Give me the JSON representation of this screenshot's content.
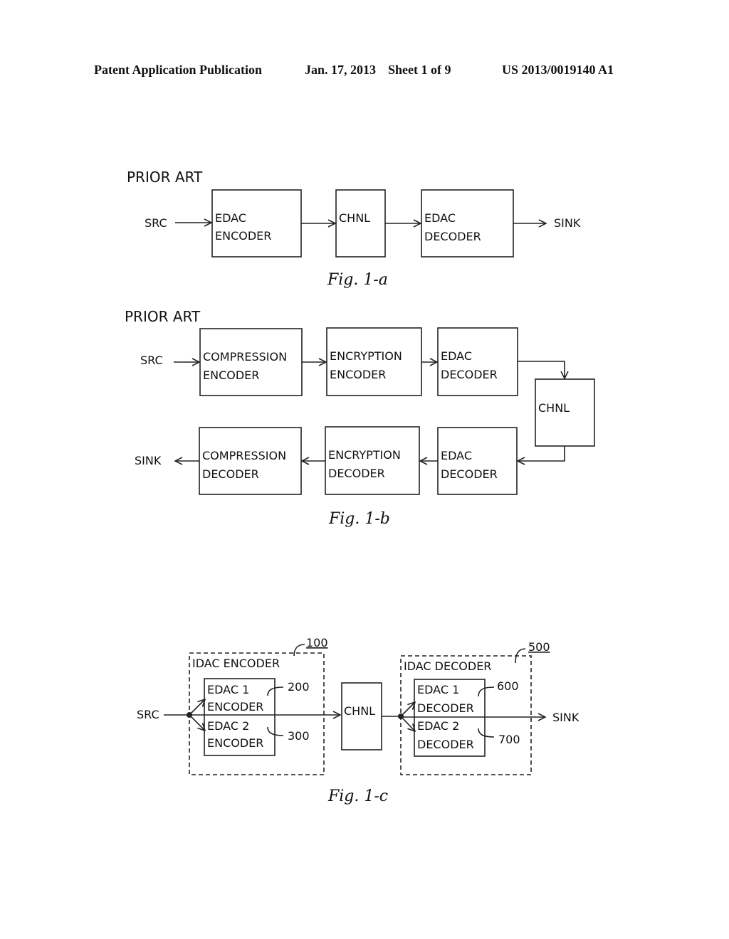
{
  "header": {
    "publication": "Patent Application Publication",
    "date": "Jan. 17, 2013",
    "sheet": "Sheet 1 of 9",
    "number": "US 2013/0019140 A1"
  },
  "fig1a": {
    "heading": "PRIOR ART",
    "src": "SRC",
    "sink": "SINK",
    "blocks": [
      {
        "line1": "EDAC",
        "line2": "ENCODER"
      },
      {
        "line1": "CHNL",
        "line2": ""
      },
      {
        "line1": "EDAC",
        "line2": "DECODER"
      }
    ],
    "caption": "Fig. 1-a"
  },
  "fig1b": {
    "heading": "PRIOR ART",
    "src": "SRC",
    "sink": "SINK",
    "top_row": [
      {
        "line1": "COMPRESSION",
        "line2": "ENCODER"
      },
      {
        "line1": "ENCRYPTION",
        "line2": "ENCODER"
      },
      {
        "line1": "EDAC",
        "line2": "DECODER"
      }
    ],
    "channel": "CHNL",
    "bottom_row": [
      {
        "line1": "COMPRESSION",
        "line2": "DECODER"
      },
      {
        "line1": "ENCRYPTION",
        "line2": "DECODER"
      },
      {
        "line1": "EDAC",
        "line2": "DECODER"
      }
    ],
    "caption": "Fig. 1-b"
  },
  "fig1c": {
    "src": "SRC",
    "sink": "SINK",
    "channel": "CHNL",
    "encoder": {
      "title": "IDAC ENCODER",
      "ref": "100",
      "sub1": {
        "line1": "EDAC 1",
        "line2": "ENCODER",
        "ref": "200"
      },
      "sub2": {
        "line1": "EDAC 2",
        "line2": "ENCODER",
        "ref": "300"
      }
    },
    "decoder": {
      "title": "IDAC DECODER",
      "ref": "500",
      "sub1": {
        "line1": "EDAC 1",
        "line2": "DECODER",
        "ref": "600"
      },
      "sub2": {
        "line1": "EDAC 2",
        "line2": "DECODER",
        "ref": "700"
      }
    },
    "caption": "Fig. 1-c"
  }
}
